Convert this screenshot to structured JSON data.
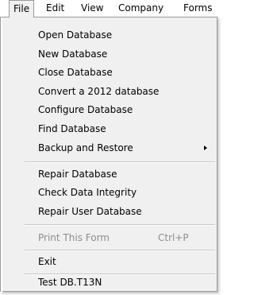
{
  "menubar": {
    "items": [
      "File",
      "Edit",
      "View",
      "Company",
      "Forms"
    ]
  },
  "file_menu": {
    "items": [
      {
        "label": "Open  Database"
      },
      {
        "label": "New Database"
      },
      {
        "label": "Close Database"
      },
      {
        "label": "Convert a 2012 database"
      },
      {
        "label": "Configure Database"
      },
      {
        "label": "Find Database"
      },
      {
        "label": "Backup and Restore"
      },
      {
        "label": "Repair Database"
      },
      {
        "label": "Check Data Integrity"
      },
      {
        "label": "Repair User Database"
      },
      {
        "label": "Print This Form",
        "shortcut": "Ctrl+P"
      },
      {
        "label": "Exit"
      },
      {
        "label": "Test DB.T13N"
      }
    ]
  }
}
